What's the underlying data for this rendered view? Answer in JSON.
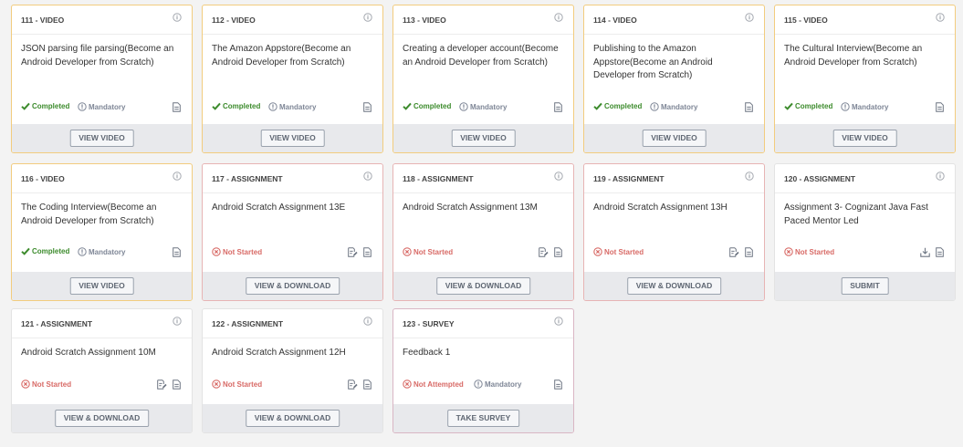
{
  "cards": [
    {
      "code": "111 - VIDEO",
      "title": "JSON parsing file parsing(Become an Android Developer from Scratch)",
      "status": "Completed",
      "mandatory": "Mandatory",
      "button": "VIEW VIDEO"
    },
    {
      "code": "112 - VIDEO",
      "title": "The Amazon Appstore(Become an Android Developer from Scratch)",
      "status": "Completed",
      "mandatory": "Mandatory",
      "button": "VIEW VIDEO"
    },
    {
      "code": "113 - VIDEO",
      "title": "Creating a developer account(Become an Android Developer from Scratch)",
      "status": "Completed",
      "mandatory": "Mandatory",
      "button": "VIEW VIDEO"
    },
    {
      "code": "114 - VIDEO",
      "title": "Publishing to the Amazon Appstore(Become an Android Developer from Scratch)",
      "status": "Completed",
      "mandatory": "Mandatory",
      "button": "VIEW VIDEO"
    },
    {
      "code": "115 - VIDEO",
      "title": "The Cultural Interview(Become an Android Developer from Scratch)",
      "status": "Completed",
      "mandatory": "Mandatory",
      "button": "VIEW VIDEO"
    },
    {
      "code": "116 - VIDEO",
      "title": "The Coding Interview(Become an Android Developer from Scratch)",
      "status": "Completed",
      "mandatory": "Mandatory",
      "button": "VIEW VIDEO"
    },
    {
      "code": "117 - ASSIGNMENT",
      "title": "Android Scratch Assignment 13E",
      "status": "Not Started",
      "button": "VIEW & DOWNLOAD"
    },
    {
      "code": "118 - ASSIGNMENT",
      "title": "Android Scratch Assignment 13M",
      "status": "Not Started",
      "button": "VIEW & DOWNLOAD"
    },
    {
      "code": "119 - ASSIGNMENT",
      "title": "Android Scratch Assignment 13H",
      "status": "Not Started",
      "button": "VIEW & DOWNLOAD"
    },
    {
      "code": "120 - ASSIGNMENT",
      "title": "Assignment 3- Cognizant Java Fast Paced Mentor Led",
      "status": "Not Started",
      "button": "SUBMIT"
    },
    {
      "code": "121 - ASSIGNMENT",
      "title": "Android Scratch Assignment 10M",
      "status": "Not Started",
      "button": "VIEW & DOWNLOAD"
    },
    {
      "code": "122 - ASSIGNMENT",
      "title": "Android Scratch Assignment 12H",
      "status": "Not Started",
      "button": "VIEW & DOWNLOAD"
    },
    {
      "code": "123 - SURVEY",
      "title": "Feedback 1",
      "status": "Not Attempted",
      "mandatory": "Mandatory",
      "button": "TAKE SURVEY"
    }
  ],
  "colors": {
    "completed": "#3c8b2c",
    "not_started": "#d86a66",
    "video_border": "#f2cc7e",
    "mandatory": "#7e8696"
  },
  "icons": {
    "info": "info-icon",
    "completed": "checkmark-icon",
    "not_started": "x-circle-icon",
    "mandatory": "exclamation-circle-icon",
    "document": "document-icon",
    "edit_document": "edit-document-icon",
    "download": "download-icon"
  }
}
